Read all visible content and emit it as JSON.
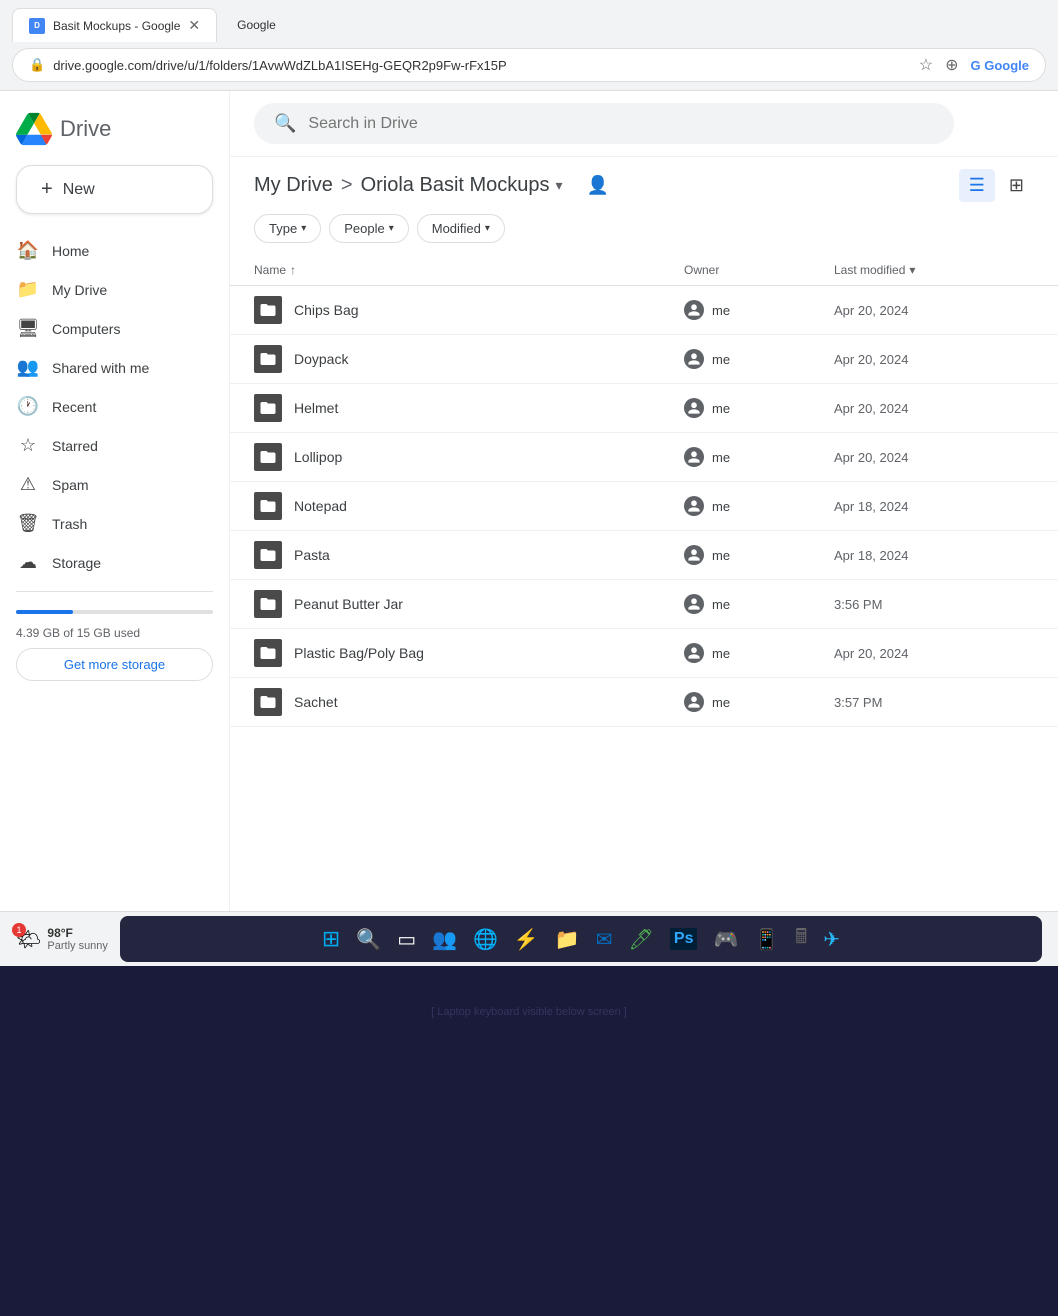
{
  "browser": {
    "url": "drive.google.com/drive/u/1/folders/1AvwWdZLbA1ISEHg-GEQR2p9Fw-rFx15P",
    "tab_title": "Basit Mockups - Google",
    "tab2_title": "Google",
    "search_placeholder": "Search in Drive"
  },
  "sidebar": {
    "logo_text": "Drive",
    "new_button": "New",
    "items": [
      {
        "id": "home",
        "label": "Home",
        "icon": "🏠"
      },
      {
        "id": "my-drive",
        "label": "My Drive",
        "icon": "📁"
      },
      {
        "id": "computers",
        "label": "Computers",
        "icon": "🖥"
      },
      {
        "id": "shared",
        "label": "Shared with me",
        "icon": "👥"
      },
      {
        "id": "recent",
        "label": "Recent",
        "icon": "🕐"
      },
      {
        "id": "starred",
        "label": "Starred",
        "icon": "☆"
      },
      {
        "id": "spam",
        "label": "Spam",
        "icon": "⚠"
      },
      {
        "id": "trash",
        "label": "Trash",
        "icon": "🗑"
      },
      {
        "id": "storage",
        "label": "Storage",
        "icon": "☁"
      }
    ],
    "storage_text": "4.39 GB of 15 GB used",
    "storage_percent": 29,
    "get_more_storage": "Get more storage"
  },
  "header": {
    "breadcrumb_root": "My Drive",
    "breadcrumb_separator": ">",
    "breadcrumb_current": "Oriola Basit Mockups",
    "share_icon": "👤"
  },
  "filters": {
    "type_label": "Type",
    "people_label": "People",
    "modified_label": "Modified"
  },
  "table": {
    "col_name": "Name",
    "col_owner": "Owner",
    "col_modified": "Last modified",
    "rows": [
      {
        "name": "Chips Bag",
        "owner": "me",
        "modified": "Apr 20, 2024"
      },
      {
        "name": "Doypack",
        "owner": "me",
        "modified": "Apr 20, 2024"
      },
      {
        "name": "Helmet",
        "owner": "me",
        "modified": "Apr 20, 2024"
      },
      {
        "name": "Lollipop",
        "owner": "me",
        "modified": "Apr 20, 2024"
      },
      {
        "name": "Notepad",
        "owner": "me",
        "modified": "Apr 18, 2024"
      },
      {
        "name": "Pasta",
        "owner": "me",
        "modified": "Apr 18, 2024"
      },
      {
        "name": "Peanut Butter Jar",
        "owner": "me",
        "modified": "3:56 PM"
      },
      {
        "name": "Plastic Bag/Poly Bag",
        "owner": "me",
        "modified": "Apr 20, 2024"
      },
      {
        "name": "Sachet",
        "owner": "me",
        "modified": "3:57 PM"
      }
    ]
  },
  "weather": {
    "temp": "98°F",
    "condition": "Partly sunny",
    "badge": "1"
  },
  "taskbar": {
    "items": [
      "⊞",
      "🔍",
      "▭",
      "👥",
      "🌐",
      "⚡",
      "📁",
      "✉",
      "🖊",
      "Ps",
      "🎮",
      "📱",
      "🖩",
      "✈"
    ]
  }
}
